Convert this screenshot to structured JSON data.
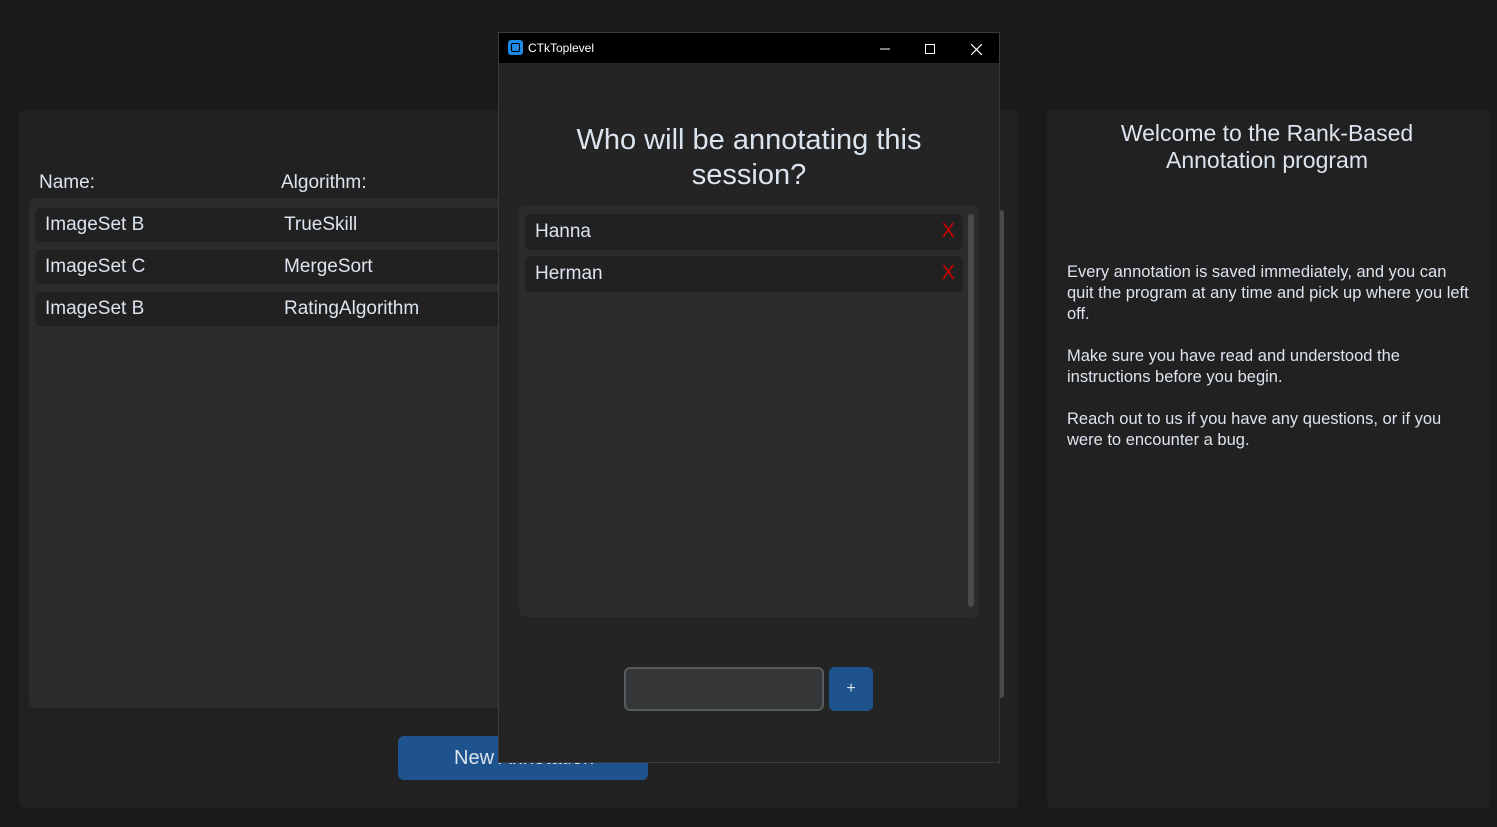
{
  "main": {
    "headers": {
      "name": "Name:",
      "algorithm": "Algorithm:"
    },
    "rows": [
      {
        "name": "ImageSet B",
        "algorithm": "TrueSkill"
      },
      {
        "name": "ImageSet C",
        "algorithm": "MergeSort"
      },
      {
        "name": "ImageSet B",
        "algorithm": "RatingAlgorithm"
      }
    ],
    "new_button_label": "New Annotation"
  },
  "welcome": {
    "title": "Welcome to the Rank-Based Annotation program",
    "paragraphs": [
      "Every annotation is saved immediately, and you can quit the program at any time and pick up where you left off.",
      "Make sure you have read and understood the instructions before you begin.",
      "Reach out to us if you have any questions, or if you were to encounter a bug."
    ]
  },
  "dialog": {
    "window_title": "CTkToplevel",
    "icons": {
      "app": "app-icon",
      "minimize": "minimize-icon",
      "maximize": "maximize-icon",
      "close": "close-icon"
    },
    "question": "Who will be annotating this session?",
    "users": [
      {
        "name": "Hanna",
        "remove_label": "X"
      },
      {
        "name": "Herman",
        "remove_label": "X"
      }
    ],
    "input_value": "",
    "add_label": "+"
  },
  "colors": {
    "accent": "#1f538d",
    "remove": "#cc0000",
    "background": "#1a1a1a"
  }
}
